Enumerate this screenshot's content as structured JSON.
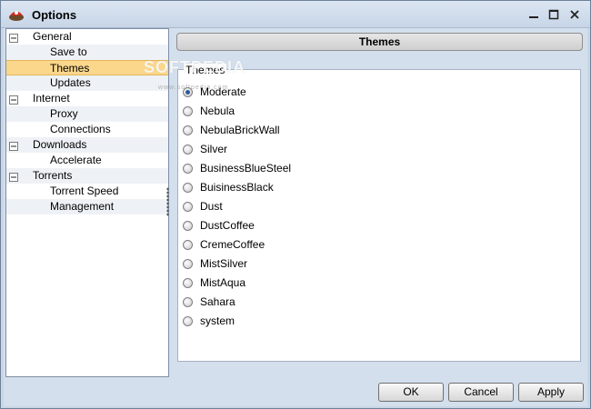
{
  "window": {
    "title": "Options",
    "icon": "app-logo-icon"
  },
  "watermark": {
    "text": "SOFTPEDIA",
    "sub": "www.softpedia.com"
  },
  "tree": {
    "items": [
      {
        "label": "General",
        "level": 0,
        "expanded": true
      },
      {
        "label": "Save to",
        "level": 1
      },
      {
        "label": "Themes",
        "level": 1,
        "selected": true
      },
      {
        "label": "Updates",
        "level": 1
      },
      {
        "label": "Internet",
        "level": 0,
        "expanded": true
      },
      {
        "label": "Proxy",
        "level": 1
      },
      {
        "label": "Connections",
        "level": 1
      },
      {
        "label": "Downloads",
        "level": 0,
        "expanded": true
      },
      {
        "label": "Accelerate",
        "level": 1
      },
      {
        "label": "Torrents",
        "level": 0,
        "expanded": true
      },
      {
        "label": "Torrent Speed",
        "level": 1
      },
      {
        "label": "Management",
        "level": 1
      }
    ]
  },
  "panel": {
    "header": "Themes",
    "group_label": "Themes",
    "options": [
      {
        "label": "Moderate",
        "checked": true
      },
      {
        "label": "Nebula"
      },
      {
        "label": "NebulaBrickWall"
      },
      {
        "label": "Silver"
      },
      {
        "label": "BusinessBlueSteel"
      },
      {
        "label": "BuisinessBlack"
      },
      {
        "label": "Dust"
      },
      {
        "label": "DustCoffee"
      },
      {
        "label": "CremeCoffee"
      },
      {
        "label": "MistSilver"
      },
      {
        "label": "MistAqua"
      },
      {
        "label": "Sahara"
      },
      {
        "label": "system"
      }
    ]
  },
  "buttons": {
    "ok": "OK",
    "cancel": "Cancel",
    "apply": "Apply"
  },
  "colors": {
    "selection": "#fbd78c",
    "radio_dot": "#2f5b9a",
    "frame": "#d3dfec"
  }
}
